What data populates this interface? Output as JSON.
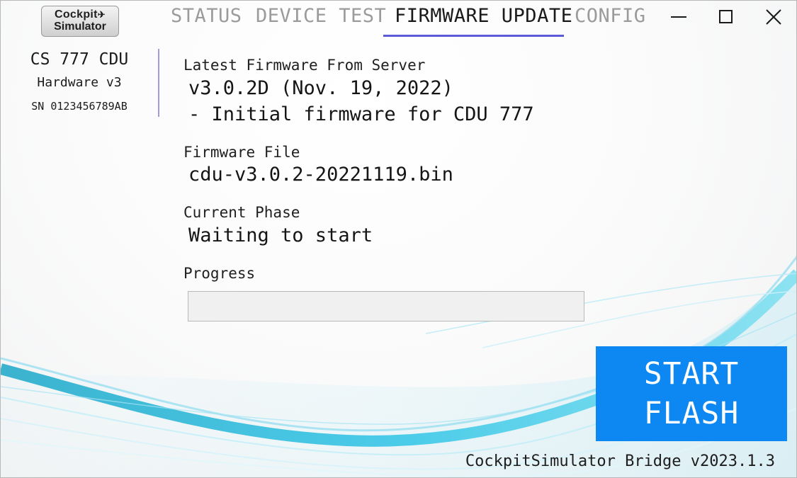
{
  "app": {
    "logo": {
      "line1": "Cockpit",
      "line2": "Simulator"
    },
    "version_label": "CockpitSimulator Bridge v2023.1.3"
  },
  "tabs": [
    {
      "label": "STATUS",
      "active": false
    },
    {
      "label": "DEVICE TEST",
      "active": false
    },
    {
      "label": "FIRMWARE UPDATE",
      "active": true
    },
    {
      "label": "CONFIG",
      "active": false
    }
  ],
  "window_controls": {
    "icons": [
      "minimize-icon",
      "maximize-icon",
      "close-icon"
    ]
  },
  "device": {
    "model": "CS 777 CDU",
    "hardware": "Hardware v3",
    "serial": "SN 0123456789AB"
  },
  "firmware": {
    "latest_label": "Latest Firmware From Server",
    "latest_version": "v3.0.2D (Nov. 19, 2022)",
    "latest_notes": "- Initial firmware for CDU 777",
    "file_label": "Firmware File",
    "file_name": "cdu-v3.0.2-20221119.bin",
    "phase_label": "Current Phase",
    "phase_value": "Waiting to start",
    "progress_label": "Progress",
    "progress_fraction": 0
  },
  "actions": {
    "start_flash_line1": "START",
    "start_flash_line2": "FLASH"
  },
  "colors": {
    "accent": "#5b5ad8",
    "button": "#0d88f2",
    "inactive_tab": "#9b9b9b",
    "wave": "#2ec4e6"
  }
}
